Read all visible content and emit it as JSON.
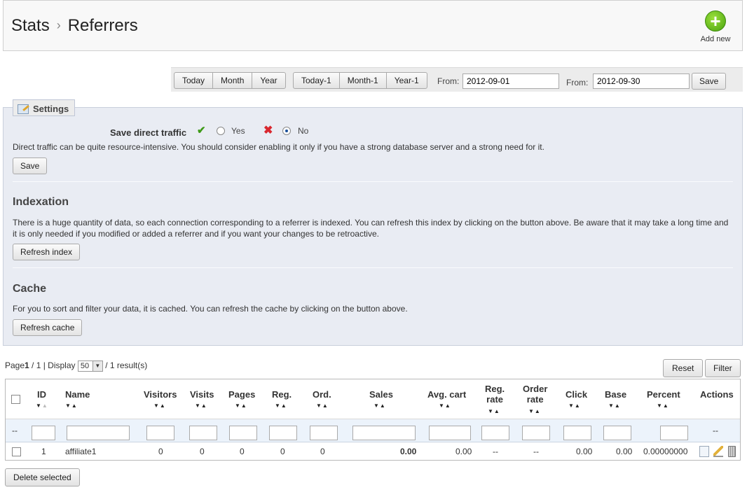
{
  "header": {
    "breadcrumb_parent": "Stats",
    "breadcrumb_sep": "›",
    "breadcrumb_current": "Referrers",
    "add_new_label": "Add new",
    "add_new_icon": "plus-circle-icon"
  },
  "datebar": {
    "buttons1": [
      "Today",
      "Month",
      "Year"
    ],
    "buttons2": [
      "Today-1",
      "Month-1",
      "Year-1"
    ],
    "from_label": "From:",
    "from_value": "2012-09-01",
    "to_label": "From:",
    "to_value": "2012-09-30",
    "save_label": "Save"
  },
  "settings": {
    "legend": "Settings",
    "direct_traffic_label": "Save direct traffic",
    "yes_label": "Yes",
    "no_label": "No",
    "selected": "No",
    "direct_traffic_help": "Direct traffic can be quite resource-intensive. You should consider enabling it only if you have a strong database server and a strong need for it.",
    "save_label": "Save",
    "indexation_title": "Indexation",
    "indexation_text": "There is a huge quantity of data, so each connection corresponding to a referrer is indexed. You can refresh this index by clicking on the button above. Be aware that it may take a long time and it is only needed if you modified or added a referrer and if you want your changes to be retroactive.",
    "refresh_index_label": "Refresh index",
    "cache_title": "Cache",
    "cache_text": "For you to sort and filter your data, it is cached. You can refresh the cache by clicking on the button above.",
    "refresh_cache_label": "Refresh cache"
  },
  "pager": {
    "page_prefix": "Page",
    "page_current": "1",
    "page_total": " / 1 | Display ",
    "per_page": "50",
    "results": " / 1 result(s)",
    "reset_label": "Reset",
    "filter_label": "Filter"
  },
  "table": {
    "headers": {
      "id": "ID",
      "name": "Name",
      "visitors": "Visitors",
      "visits": "Visits",
      "pages": "Pages",
      "reg": "Reg.",
      "ord": "Ord.",
      "sales": "Sales",
      "avg_cart": "Avg. cart",
      "reg_rate_1": "Reg.",
      "reg_rate_2": "rate",
      "order_rate_1": "Order",
      "order_rate_2": "rate",
      "click": "Click",
      "base": "Base",
      "percent": "Percent",
      "actions": "Actions"
    },
    "filter_dash": "--",
    "filter_actions_dash": "--",
    "row": {
      "id": "1",
      "name": "affiliate1",
      "visitors": "0",
      "visits": "0",
      "pages": "0",
      "reg": "0",
      "ord": "0",
      "sales": "0.00",
      "avg_cart": "0.00",
      "reg_rate": "--",
      "order_rate": "--",
      "click": "0.00",
      "base": "0.00",
      "percent": "0.00000000"
    },
    "action_icons": [
      "view-icon",
      "edit-icon",
      "delete-icon"
    ]
  },
  "footer": {
    "delete_selected_label": "Delete selected"
  },
  "colors": {
    "panel_bg": "#e9ecf3",
    "filter_row_bg": "#ecf3fb",
    "add_new_green": "#49a30f"
  }
}
